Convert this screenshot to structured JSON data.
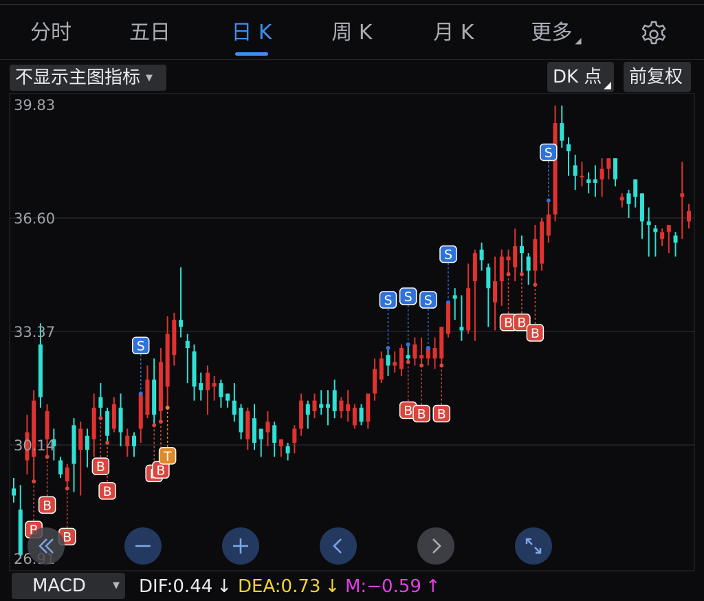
{
  "tabs": [
    {
      "label": "分时",
      "active": false
    },
    {
      "label": "五日",
      "active": false
    },
    {
      "label": "日 K",
      "active": true
    },
    {
      "label": "周 K",
      "active": false
    },
    {
      "label": "月 K",
      "active": false
    },
    {
      "label": "更多",
      "active": false
    }
  ],
  "settings_icon": "gear-icon",
  "toolbar": {
    "indicator_select": "不显示主图指标",
    "dk_button": "DK 点",
    "adjust_button": "前复权"
  },
  "colors": {
    "up": "#e0322f",
    "down": "#2fe0d4",
    "accent": "#3d8ef0",
    "sell_marker": "#2f73d8",
    "buy_marker": "#d9463e",
    "t_marker": "#e0892a",
    "dif": "#e8eaed",
    "dea": "#f1d232",
    "m": "#e240e6"
  },
  "chart_data": {
    "type": "candlestick",
    "y_axis_labels": [
      "39.83",
      "36.60",
      "33.37",
      "30.14",
      "26.91"
    ],
    "ylim": [
      26.91,
      39.83
    ],
    "grid": true,
    "candles": [
      [
        28.9,
        28.7,
        29.2,
        28.5
      ],
      [
        28.3,
        27.0,
        29.0,
        26.9
      ],
      [
        29.7,
        30.5,
        31.0,
        29.3
      ],
      [
        29.8,
        31.4,
        31.7,
        29.1
      ],
      [
        33.0,
        31.5,
        33.6,
        31.2
      ],
      [
        30.3,
        31.1,
        31.3,
        29.8
      ],
      [
        30.3,
        30.1,
        30.6,
        29.7
      ],
      [
        29.7,
        29.3,
        29.8,
        29.2
      ],
      [
        29.1,
        29.5,
        29.6,
        28.9
      ],
      [
        30.7,
        29.6,
        30.9,
        28.8
      ],
      [
        30.0,
        30.6,
        30.8,
        28.7
      ],
      [
        30.4,
        30.0,
        30.6,
        29.5
      ],
      [
        30.3,
        31.2,
        31.6,
        29.8
      ],
      [
        31.5,
        31.2,
        31.9,
        30.9
      ],
      [
        31.1,
        30.4,
        31.2,
        30.2
      ],
      [
        30.6,
        31.3,
        31.5,
        30.5
      ],
      [
        31.2,
        30.5,
        31.6,
        30.1
      ],
      [
        30.1,
        30.4,
        30.6,
        29.8
      ],
      [
        30.4,
        30.1,
        30.5,
        29.8
      ],
      [
        30.6,
        31.6,
        31.6,
        30.2
      ],
      [
        31.0,
        32.0,
        32.4,
        30.9
      ],
      [
        32.0,
        31.0,
        32.6,
        30.7
      ],
      [
        31.1,
        32.5,
        32.9,
        30.8
      ],
      [
        31.8,
        33.3,
        33.8,
        31.2
      ],
      [
        32.7,
        33.7,
        33.9,
        32.4
      ],
      [
        33.7,
        33.5,
        35.2,
        33.2
      ],
      [
        33.1,
        32.9,
        33.3,
        31.9
      ],
      [
        32.8,
        31.8,
        33.0,
        31.4
      ],
      [
        31.9,
        31.7,
        32.2,
        31.4
      ],
      [
        31.7,
        32.2,
        32.4,
        31.0
      ],
      [
        31.8,
        31.9,
        32.1,
        31.4
      ],
      [
        31.9,
        31.5,
        32.0,
        31.2
      ],
      [
        31.6,
        31.4,
        31.6,
        31.2
      ],
      [
        31.4,
        31.0,
        31.9,
        30.8
      ],
      [
        31.2,
        30.5,
        31.3,
        30.3
      ],
      [
        30.3,
        31.1,
        31.2,
        30.0
      ],
      [
        30.9,
        30.2,
        31.3,
        30.0
      ],
      [
        30.6,
        30.3,
        30.6,
        29.8
      ],
      [
        30.5,
        30.8,
        31.1,
        30.1
      ],
      [
        30.7,
        30.2,
        30.8,
        29.8
      ],
      [
        30.1,
        30.3,
        30.3,
        29.8
      ],
      [
        30.1,
        29.9,
        30.2,
        29.7
      ],
      [
        30.2,
        30.6,
        30.7,
        29.9
      ],
      [
        30.6,
        31.4,
        31.6,
        30.4
      ],
      [
        31.3,
        31.0,
        31.4,
        30.6
      ],
      [
        31.1,
        31.4,
        31.6,
        30.9
      ],
      [
        31.3,
        31.2,
        31.7,
        31.0
      ],
      [
        31.3,
        31.2,
        31.7,
        30.7
      ],
      [
        31.7,
        31.1,
        32.0,
        30.9
      ],
      [
        31.1,
        31.4,
        31.5,
        30.9
      ],
      [
        31.1,
        31.3,
        31.7,
        30.8
      ],
      [
        30.7,
        31.2,
        31.3,
        30.6
      ],
      [
        31.2,
        30.8,
        31.3,
        30.7
      ],
      [
        30.8,
        31.6,
        31.6,
        30.6
      ],
      [
        31.6,
        32.3,
        32.6,
        31.4
      ],
      [
        32.0,
        32.6,
        32.8,
        31.9
      ],
      [
        32.7,
        32.4,
        32.9,
        32.1
      ],
      [
        32.4,
        32.5,
        32.8,
        32.2
      ],
      [
        32.3,
        32.9,
        33.0,
        32.1
      ],
      [
        32.7,
        32.6,
        33.0,
        32.5
      ],
      [
        32.6,
        33.0,
        33.2,
        32.4
      ],
      [
        32.6,
        32.7,
        33.2,
        32.4
      ],
      [
        32.6,
        32.9,
        32.9,
        32.4
      ],
      [
        32.6,
        32.9,
        33.2,
        32.3
      ],
      [
        32.6,
        33.5,
        33.5,
        32.4
      ],
      [
        33.3,
        34.2,
        34.2,
        33.2
      ],
      [
        34.4,
        34.3,
        34.6,
        33.7
      ],
      [
        33.5,
        33.4,
        34.4,
        33.1
      ],
      [
        33.4,
        34.6,
        35.3,
        33.3
      ],
      [
        34.8,
        35.6,
        35.7,
        33.1
      ],
      [
        35.7,
        35.4,
        35.9,
        35.1
      ],
      [
        35.2,
        34.6,
        35.3,
        33.5
      ],
      [
        34.2,
        34.8,
        35.5,
        33.4
      ],
      [
        34.8,
        35.5,
        35.7,
        34.1
      ],
      [
        35.4,
        35.5,
        35.7,
        35.0
      ],
      [
        35.2,
        35.8,
        36.3,
        34.8
      ],
      [
        35.8,
        35.6,
        36.1,
        35.0
      ],
      [
        35.5,
        35.1,
        35.6,
        34.7
      ],
      [
        35.1,
        36.0,
        36.4,
        34.7
      ],
      [
        35.3,
        36.5,
        36.6,
        35.1
      ],
      [
        36.1,
        36.7,
        37.1,
        35.9
      ],
      [
        36.7,
        39.3,
        39.8,
        36.5
      ],
      [
        39.3,
        38.8,
        39.8,
        38.6
      ],
      [
        38.7,
        38.5,
        38.9,
        37.8
      ],
      [
        38.1,
        37.8,
        38.4,
        37.4
      ],
      [
        37.8,
        37.8,
        38.2,
        37.5
      ],
      [
        37.7,
        37.6,
        37.9,
        37.3
      ],
      [
        37.7,
        37.6,
        38.1,
        37.2
      ],
      [
        37.7,
        38.0,
        38.3,
        37.2
      ],
      [
        38.0,
        38.3,
        38.3,
        37.7
      ],
      [
        38.3,
        37.7,
        38.3,
        37.5
      ],
      [
        37.1,
        37.2,
        37.3,
        36.9
      ],
      [
        37.3,
        37.0,
        37.4,
        36.6
      ],
      [
        37.7,
        37.2,
        37.7,
        36.9
      ],
      [
        37.3,
        36.5,
        37.3,
        36.0
      ],
      [
        36.5,
        36.4,
        36.9,
        35.5
      ],
      [
        36.3,
        36.2,
        36.4,
        35.5
      ],
      [
        36.0,
        36.2,
        36.3,
        35.8
      ],
      [
        36.2,
        36.4,
        36.4,
        35.6
      ],
      [
        36.1,
        35.9,
        36.2,
        35.5
      ],
      [
        37.2,
        37.3,
        38.2,
        36.0
      ],
      [
        36.5,
        36.8,
        37.0,
        36.3
      ]
    ],
    "signals": [
      {
        "label": "B",
        "candle": 3
      },
      {
        "label": "B",
        "candle": 5
      },
      {
        "label": "B",
        "candle": 8
      },
      {
        "label": "B",
        "candle": 13
      },
      {
        "label": "B",
        "candle": 14
      },
      {
        "label": "S",
        "candle": 19
      },
      {
        "label": "B",
        "candle": 21
      },
      {
        "label": "B",
        "candle": 22
      },
      {
        "label": "T",
        "candle": 23
      },
      {
        "label": "S",
        "candle": 56
      },
      {
        "label": "S",
        "candle": 59
      },
      {
        "label": "B",
        "candle": 59
      },
      {
        "label": "B",
        "candle": 61
      },
      {
        "label": "S",
        "candle": 62
      },
      {
        "label": "B",
        "candle": 64
      },
      {
        "label": "S",
        "candle": 65
      },
      {
        "label": "B",
        "candle": 74
      },
      {
        "label": "B",
        "candle": 76
      },
      {
        "label": "B",
        "candle": 78
      },
      {
        "label": "S",
        "candle": 80
      }
    ]
  },
  "controls": [
    "double-left-icon",
    "zoom-out-icon",
    "zoom-in-icon",
    "chevron-left-icon",
    "chevron-right-icon",
    "fullscreen-icon"
  ],
  "indicator": {
    "name": "MACD",
    "dif": "DIF:0.44",
    "dif_arrow": "↓",
    "dea": "DEA:0.73",
    "dea_arrow": "↓",
    "m": "M:−0.59",
    "m_arrow": "↑"
  }
}
